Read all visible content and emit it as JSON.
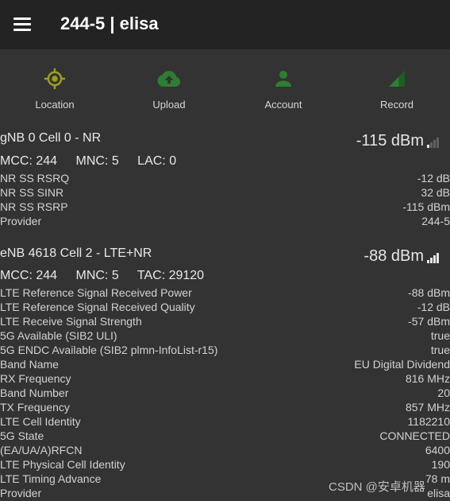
{
  "app": {
    "title": "244-5 | elisa"
  },
  "actions": [
    {
      "label": "Location",
      "icon": "location-crosshair-icon",
      "color": "#9e9d24"
    },
    {
      "label": "Upload",
      "icon": "cloud-upload-icon",
      "color": "#2e7d32"
    },
    {
      "label": "Account",
      "icon": "account-icon",
      "color": "#2e7d32"
    },
    {
      "label": "Record",
      "icon": "record-signal-icon",
      "color": "#2e7d32"
    }
  ],
  "cells": [
    {
      "header": "gNB 0 Cell 0 - NR",
      "dbm": "-115 dBm",
      "signal_level": 0.25,
      "ids": [
        "MCC: 244",
        "MNC: 5",
        "LAC: 0"
      ],
      "rows": [
        {
          "k": "NR SS RSRQ",
          "v": "-12 dB"
        },
        {
          "k": "NR SS SINR",
          "v": "32 dB"
        },
        {
          "k": "NR SS RSRP",
          "v": "-115 dBm"
        },
        {
          "k": "Provider",
          "v": "244-5"
        }
      ]
    },
    {
      "header": "eNB 4618 Cell 2 - LTE+NR",
      "dbm": "-88 dBm",
      "signal_level": 1.0,
      "ids": [
        "MCC: 244",
        "MNC: 5",
        "TAC: 29120"
      ],
      "rows": [
        {
          "k": "LTE Reference Signal Received Power",
          "v": "-88 dBm"
        },
        {
          "k": "LTE Reference Signal Received Quality",
          "v": "-12 dB"
        },
        {
          "k": "LTE Receive Signal Strength",
          "v": "-57 dBm"
        },
        {
          "k": "5G Available (SIB2 ULI)",
          "v": "true"
        },
        {
          "k": "5G ENDC Available (SIB2 plmn-InfoList-r15)",
          "v": "true"
        },
        {
          "k": "Band Name",
          "v": "EU Digital Dividend"
        },
        {
          "k": "RX Frequency",
          "v": "816 MHz"
        },
        {
          "k": "Band Number",
          "v": "20"
        },
        {
          "k": "TX Frequency",
          "v": "857 MHz"
        },
        {
          "k": "LTE Cell Identity",
          "v": "1182210"
        },
        {
          "k": "5G State",
          "v": "CONNECTED"
        },
        {
          "k": "(EA/UA/A)RFCN",
          "v": "6400"
        },
        {
          "k": "LTE Physical Cell Identity",
          "v": "190"
        },
        {
          "k": "LTE Timing Advance",
          "v": "78 m"
        },
        {
          "k": "Provider",
          "v": "elisa"
        }
      ]
    }
  ],
  "watermark": "CSDN @安卓机器"
}
